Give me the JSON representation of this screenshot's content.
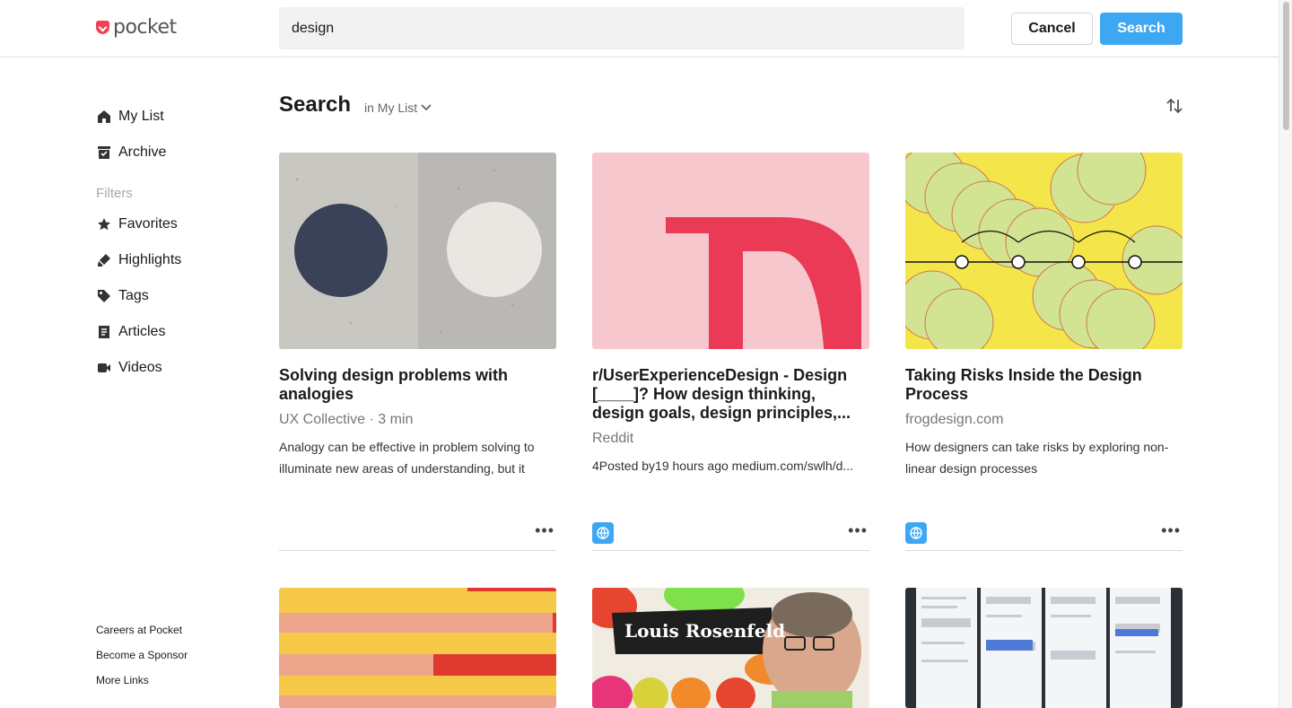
{
  "app": {
    "logo_text": "pocket"
  },
  "header": {
    "search_value": "design",
    "cancel_label": "Cancel",
    "search_label": "Search"
  },
  "sidebar": {
    "items": [
      {
        "label": "My List",
        "icon": "home-icon"
      },
      {
        "label": "Archive",
        "icon": "archive-icon"
      }
    ],
    "filters_label": "Filters",
    "filters": [
      {
        "label": "Favorites",
        "icon": "star-icon"
      },
      {
        "label": "Highlights",
        "icon": "highlighter-icon"
      },
      {
        "label": "Tags",
        "icon": "tag-icon"
      },
      {
        "label": "Articles",
        "icon": "article-icon"
      },
      {
        "label": "Videos",
        "icon": "video-icon"
      }
    ],
    "footer": [
      "Careers at Pocket",
      "Become a Sponsor",
      "More Links"
    ]
  },
  "main": {
    "title": "Search",
    "scope": "in My List",
    "cards": [
      {
        "title": "Solving design problems with analogies",
        "source": "UX Collective · 3 min",
        "excerpt": "Analogy can be effective in problem solving to illuminate new areas of understanding, but it",
        "has_globe": false
      },
      {
        "title": "r/UserExperienceDesign - Design [____]? How design thinking, design goals, design principles,...",
        "source": "Reddit",
        "excerpt": "4Posted by19 hours ago medium.com/swlh/d...",
        "has_globe": true
      },
      {
        "title": "Taking Risks Inside the Design Process",
        "source": "frogdesign.com",
        "excerpt": "How designers can take risks by exploring non-linear design processes",
        "has_globe": true
      }
    ],
    "row2_card_text": "Louis Rosenfeld"
  },
  "colors": {
    "accent": "#3ea7f3",
    "brand": "#ef4056"
  }
}
